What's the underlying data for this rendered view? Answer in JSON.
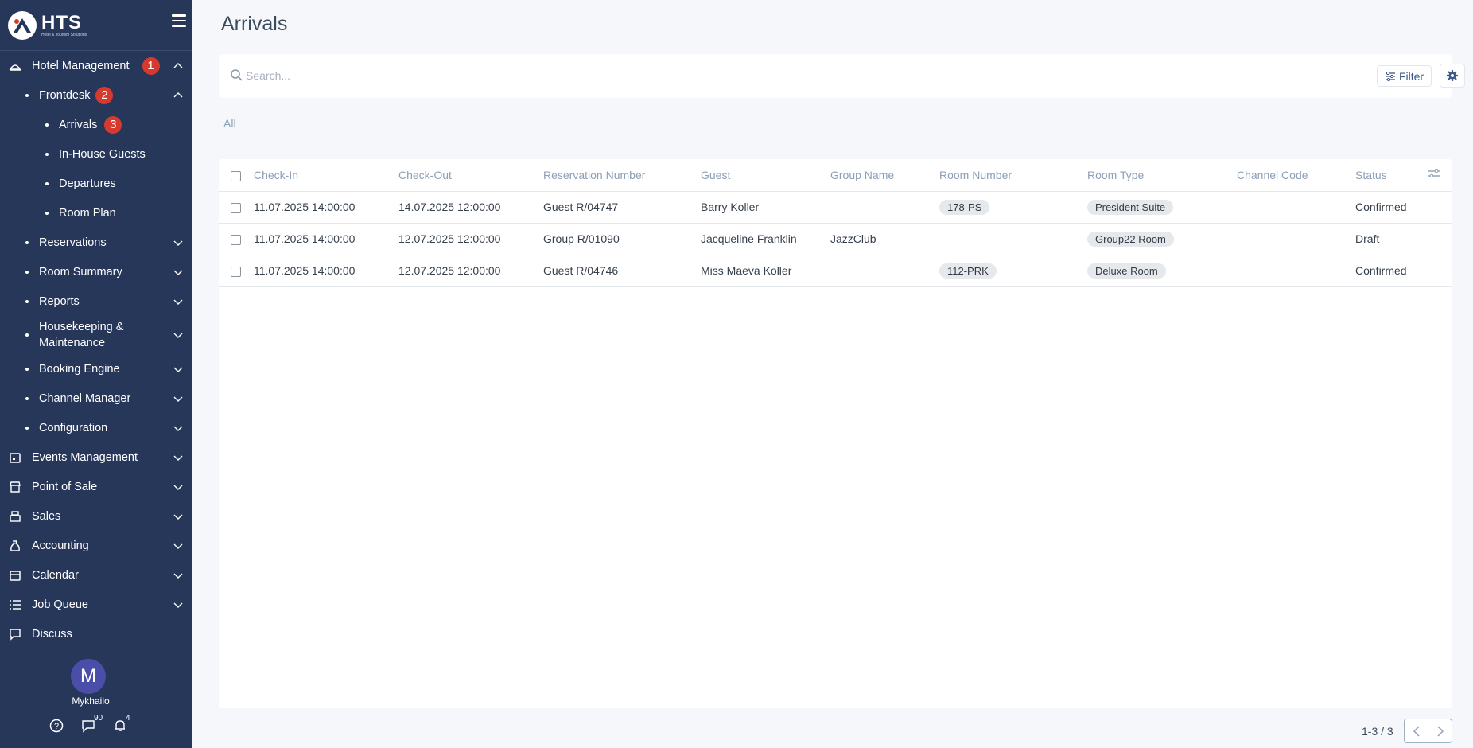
{
  "app": {
    "logo_title": "HTS",
    "logo_subtitle": "Hotel & Tourism Solutions"
  },
  "sidebar": {
    "hotel_management": {
      "label": "Hotel Management",
      "badge": "1"
    },
    "frontdesk": {
      "label": "Frontdesk",
      "badge": "2"
    },
    "arrivals": {
      "label": "Arrivals",
      "badge": "3"
    },
    "in_house_guests": "In-House Guests",
    "departures": "Departures",
    "room_plan": "Room Plan",
    "reservations": "Reservations",
    "room_summary": "Room Summary",
    "reports": "Reports",
    "housekeeping_line1": "Housekeeping &",
    "housekeeping_line2": "Maintenance",
    "booking_engine": "Booking Engine",
    "channel_manager": "Channel Manager",
    "configuration": "Configuration",
    "events_management": "Events Management",
    "point_of_sale": "Point of Sale",
    "sales": "Sales",
    "accounting": "Accounting",
    "calendar": "Calendar",
    "job_queue": "Job Queue",
    "discuss": "Discuss"
  },
  "user": {
    "initial": "M",
    "name": "Mykhailo",
    "messages_count": "90",
    "notifications_count": "4"
  },
  "page": {
    "title": "Arrivals"
  },
  "search": {
    "placeholder": "Search..."
  },
  "toolbar": {
    "filter_label": "Filter"
  },
  "tabs": {
    "all": "All"
  },
  "table": {
    "headers": {
      "check_in": "Check-In",
      "check_out": "Check-Out",
      "reservation_number": "Reservation Number",
      "guest": "Guest",
      "group_name": "Group Name",
      "room_number": "Room Number",
      "room_type": "Room Type",
      "channel_code": "Channel Code",
      "status": "Status"
    },
    "rows": [
      {
        "check_in": "11.07.2025 14:00:00",
        "check_out": "14.07.2025 12:00:00",
        "reservation_number": "Guest R/04747",
        "guest": "Barry Koller",
        "group_name": "",
        "room_number": "178-PS",
        "room_type": "President Suite",
        "channel_code": "",
        "status": "Confirmed"
      },
      {
        "check_in": "11.07.2025 14:00:00",
        "check_out": "12.07.2025 12:00:00",
        "reservation_number": "Group R/01090",
        "guest": "Jacqueline Franklin",
        "group_name": "JazzClub",
        "room_number": "",
        "room_type": "Group22 Room",
        "channel_code": "",
        "status": "Draft"
      },
      {
        "check_in": "11.07.2025 14:00:00",
        "check_out": "12.07.2025 12:00:00",
        "reservation_number": "Guest R/04746",
        "guest": "Miss Maeva Koller",
        "group_name": "",
        "room_number": "112-PRK",
        "room_type": "Deluxe Room",
        "channel_code": "",
        "status": "Confirmed"
      }
    ]
  },
  "pager": {
    "text": "1-3 / 3"
  },
  "colors": {
    "sidebar_bg": "#27375a",
    "badge_red": "#d63a2e",
    "accent_blue": "#3b5a86"
  }
}
